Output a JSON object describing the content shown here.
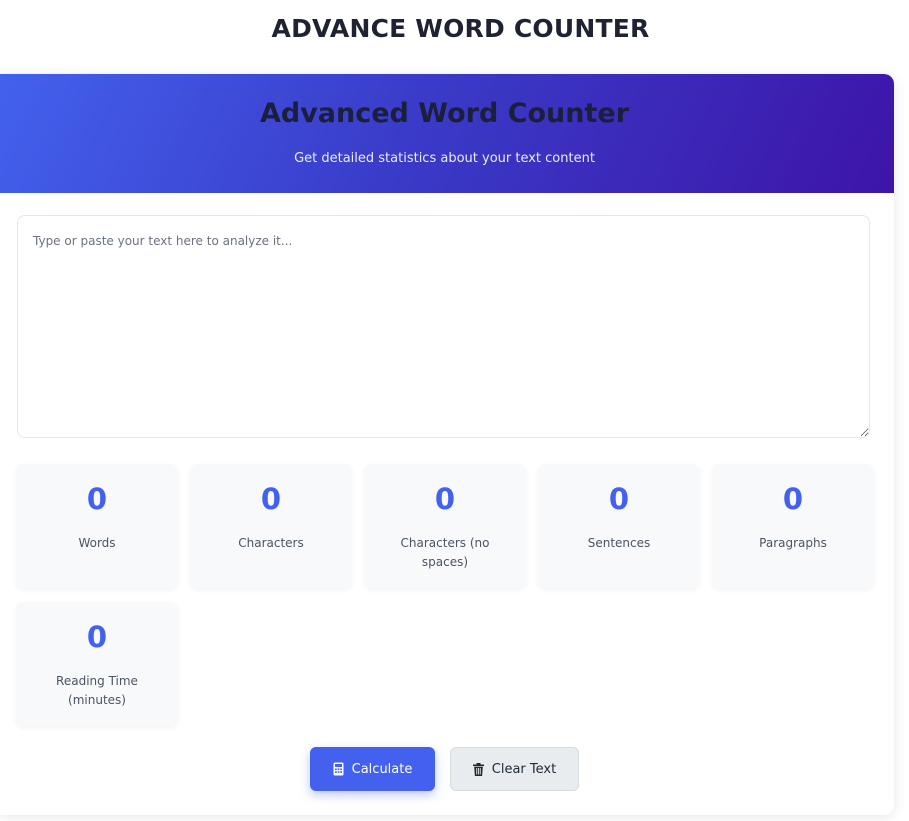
{
  "page": {
    "title": "ADVANCE WORD COUNTER"
  },
  "header": {
    "title": "Advanced Word Counter",
    "subtitle": "Get detailed statistics about your text content"
  },
  "editor": {
    "placeholder": "Type or paste your text here to analyze it...",
    "value": ""
  },
  "stats": [
    {
      "value": "0",
      "label": "Words"
    },
    {
      "value": "0",
      "label": "Characters"
    },
    {
      "value": "0",
      "label": "Characters (no spaces)"
    },
    {
      "value": "0",
      "label": "Sentences"
    },
    {
      "value": "0",
      "label": "Paragraphs"
    },
    {
      "value": "0",
      "label": "Reading Time (minutes)"
    }
  ],
  "actions": {
    "calculate_label": "Calculate",
    "calculate_icon": "calculator-icon",
    "clear_label": "Clear Text",
    "clear_icon": "trash-icon"
  },
  "colors": {
    "accent": "#4361ee",
    "gradient_start": "#4361ee",
    "gradient_end": "#3d14a8",
    "stat_card_bg": "#f8f9fa",
    "clear_button_bg": "#e9ecef"
  }
}
